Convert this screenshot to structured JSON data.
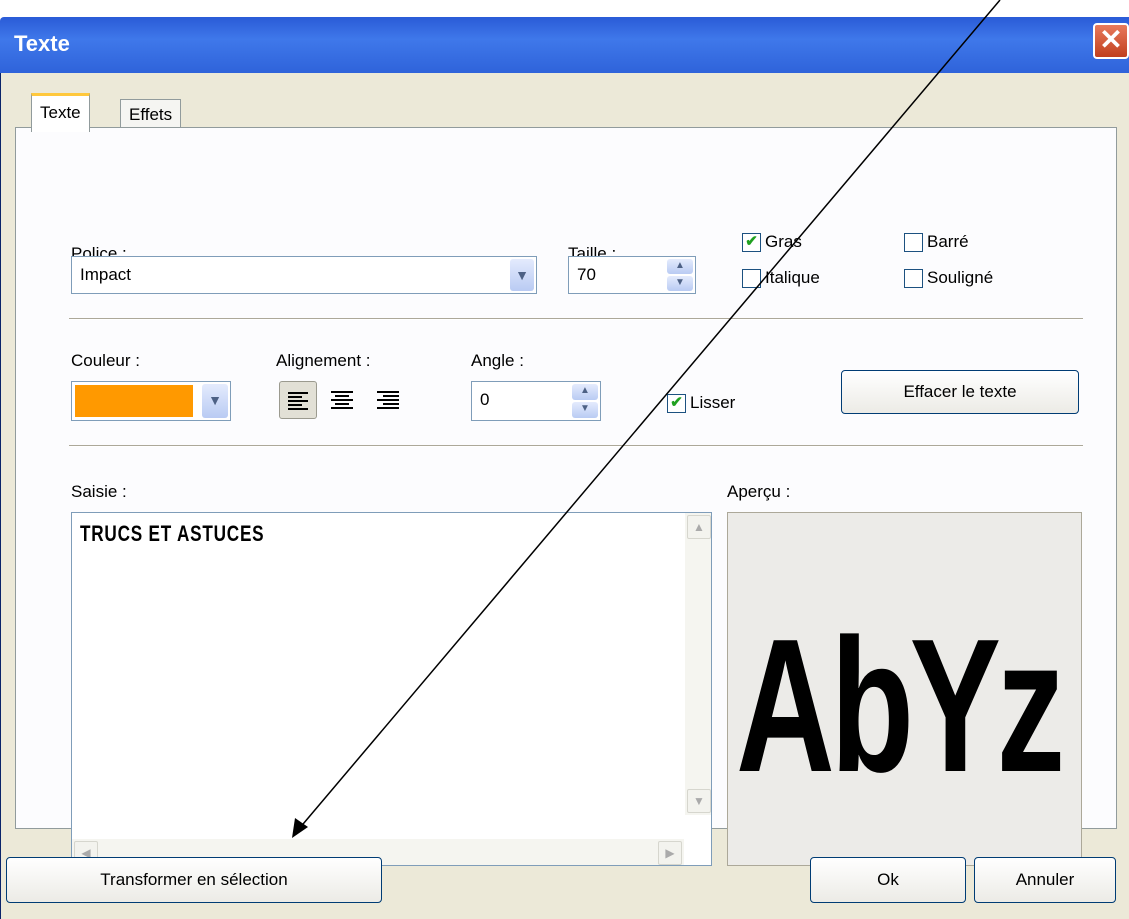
{
  "window": {
    "title": "Texte",
    "close_glyph": "✕"
  },
  "tabs": [
    {
      "label": "Texte"
    },
    {
      "label": "Effets"
    }
  ],
  "font": {
    "police_label": "Police :",
    "police_value": "Impact",
    "taille_label": "Taille :",
    "taille_value": "70"
  },
  "style": {
    "gras": {
      "label": "Gras",
      "checked": true
    },
    "italique": {
      "label": "Italique",
      "checked": false
    },
    "barre": {
      "label": "Barré",
      "checked": false
    },
    "souligne": {
      "label": "Souligné",
      "checked": false
    }
  },
  "couleur": {
    "label": "Couleur :",
    "value": "#ff9900"
  },
  "alignement": {
    "label": "Alignement :",
    "selected": "left"
  },
  "angle": {
    "label": "Angle :",
    "value": "0"
  },
  "lisser": {
    "label": "Lisser",
    "checked": true
  },
  "effacer_button": "Effacer le texte",
  "saisie": {
    "label": "Saisie :",
    "text": "TRUCS ET ASTUCES"
  },
  "apercu": {
    "label": "Aperçu :",
    "sample": "AbYz"
  },
  "buttons": {
    "transformer": "Transformer en sélection",
    "ok": "Ok",
    "annuler": "Annuler"
  },
  "icons": {
    "close": "close-icon",
    "dropdown": "chevron-down-icon",
    "spin": "spinner-icon",
    "check": "checkmark-icon",
    "align_left": "align-left-icon",
    "align_center": "align-center-icon",
    "align_right": "align-right-icon",
    "arrow": "arrow-annotation"
  },
  "colors": {
    "titlebar": "#2f63da",
    "dialog": "#ece9d8",
    "swatch": "#ff9900",
    "tab_highlight": "#ffc83c"
  }
}
